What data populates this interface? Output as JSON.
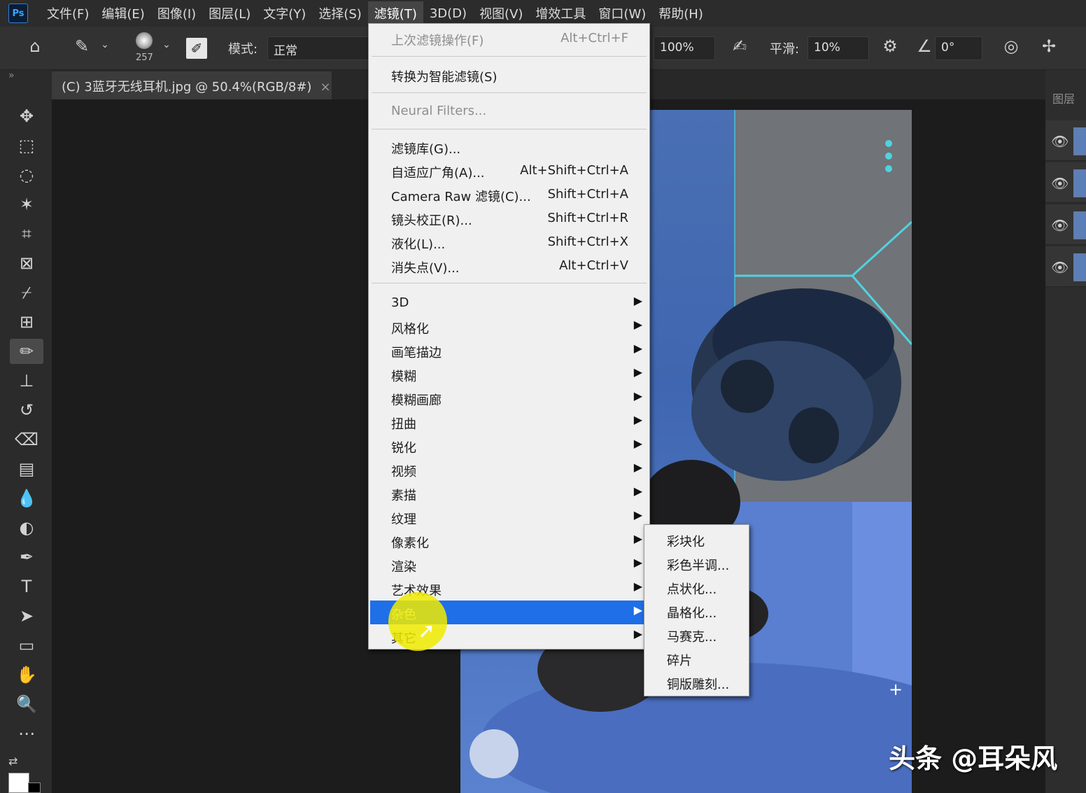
{
  "menubar": {
    "logo": "Ps",
    "items": [
      "文件(F)",
      "编辑(E)",
      "图像(I)",
      "图层(L)",
      "文字(Y)",
      "选择(S)",
      "滤镜(T)",
      "3D(D)",
      "视图(V)",
      "增效工具",
      "窗口(W)",
      "帮助(H)"
    ],
    "active_index": 6
  },
  "options": {
    "brush_size": "257",
    "mode_label": "模式:",
    "mode_value": "正常",
    "flow_value": "100%",
    "smoothing_label": "平滑:",
    "smoothing_value": "10%",
    "angle_value": "0°"
  },
  "document_tab": {
    "title": "(C) 3蓝牙无线耳机.jpg @ 50.4%(RGB/8#)",
    "close": "×"
  },
  "panel": {
    "layers_label": "图层"
  },
  "filter_menu": {
    "items": [
      {
        "label": "上次滤镜操作(F)",
        "shortcut": "Alt+Ctrl+F",
        "disabled": true
      },
      {
        "label": "转换为智能滤镜(S)",
        "shortcut": ""
      },
      {
        "label": "Neural Filters...",
        "shortcut": "",
        "disabled": true
      },
      {
        "label": "滤镜库(G)...",
        "shortcut": ""
      },
      {
        "label": "自适应广角(A)...",
        "shortcut": "Alt+Shift+Ctrl+A"
      },
      {
        "label": "Camera Raw 滤镜(C)...",
        "shortcut": "Shift+Ctrl+A"
      },
      {
        "label": "镜头校正(R)...",
        "shortcut": "Shift+Ctrl+R"
      },
      {
        "label": "液化(L)...",
        "shortcut": "Shift+Ctrl+X"
      },
      {
        "label": "消失点(V)...",
        "shortcut": "Alt+Ctrl+V"
      },
      {
        "label": "3D",
        "submenu": true
      },
      {
        "label": "风格化",
        "submenu": true
      },
      {
        "label": "画笔描边",
        "submenu": true
      },
      {
        "label": "模糊",
        "submenu": true
      },
      {
        "label": "模糊画廊",
        "submenu": true
      },
      {
        "label": "扭曲",
        "submenu": true
      },
      {
        "label": "锐化",
        "submenu": true
      },
      {
        "label": "视频",
        "submenu": true
      },
      {
        "label": "素描",
        "submenu": true
      },
      {
        "label": "纹理",
        "submenu": true
      },
      {
        "label": "像素化",
        "submenu": true
      },
      {
        "label": "渲染",
        "submenu": true
      },
      {
        "label": "艺术效果",
        "submenu": true
      },
      {
        "label": "杂色",
        "submenu": true,
        "highlight": true
      },
      {
        "label": "其它",
        "submenu": true
      }
    ],
    "submenu_arrow": "▶"
  },
  "pixelate_submenu": {
    "items": [
      "彩块化",
      "彩色半调...",
      "点状化...",
      "晶格化...",
      "马赛克...",
      "碎片",
      "铜版雕刻..."
    ]
  },
  "watermark": "头条 @耳朵风",
  "colors": {
    "menu_highlight": "#1e6fe8",
    "cursor_highlight": "#f0eb00",
    "ps_blue": "#31a8ff"
  }
}
